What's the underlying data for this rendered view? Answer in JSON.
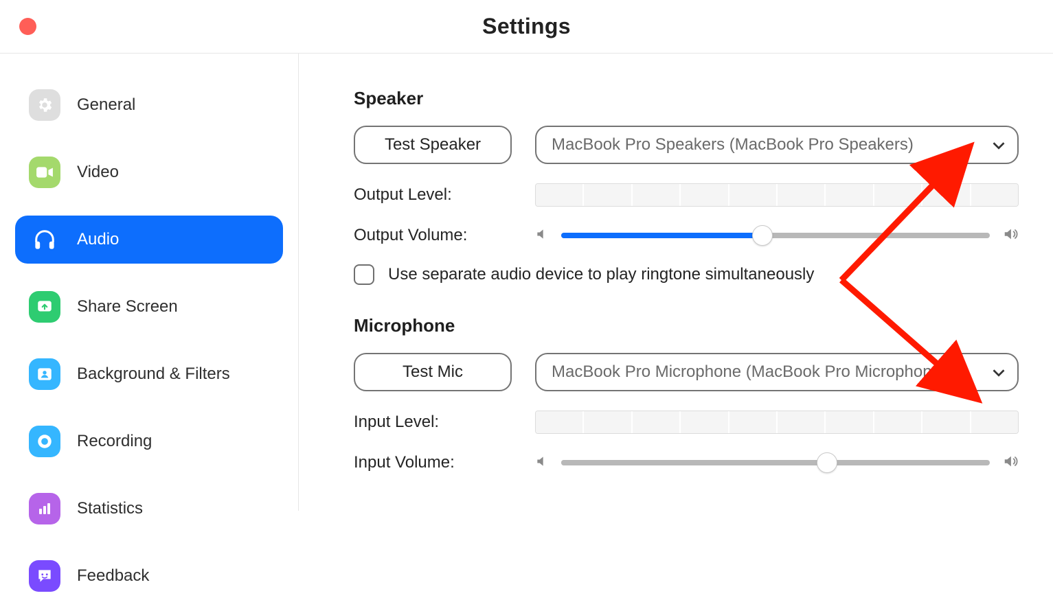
{
  "window": {
    "title": "Settings"
  },
  "sidebar": {
    "items": [
      {
        "id": "general",
        "label": "General"
      },
      {
        "id": "video",
        "label": "Video"
      },
      {
        "id": "audio",
        "label": "Audio"
      },
      {
        "id": "sharescreen",
        "label": "Share Screen"
      },
      {
        "id": "bgfilters",
        "label": "Background & Filters"
      },
      {
        "id": "recording",
        "label": "Recording"
      },
      {
        "id": "statistics",
        "label": "Statistics"
      },
      {
        "id": "feedback",
        "label": "Feedback"
      }
    ],
    "selected_id": "audio"
  },
  "audio": {
    "speaker": {
      "heading": "Speaker",
      "test_label": "Test Speaker",
      "device": "MacBook Pro Speakers (MacBook Pro Speakers)",
      "output_level_label": "Output Level:",
      "output_volume_label": "Output Volume:",
      "output_volume_percent": 47,
      "separate_ringtone_checked": false,
      "separate_ringtone_label": "Use separate audio device to play ringtone simultaneously"
    },
    "microphone": {
      "heading": "Microphone",
      "test_label": "Test Mic",
      "device": "MacBook Pro Microphone (MacBook Pro Microphone)",
      "input_level_label": "Input Level:",
      "input_volume_label": "Input Volume:",
      "input_volume_percent": 62
    }
  },
  "annotation": {
    "type": "double-arrow",
    "color": "#ff1a00",
    "note": "red annotation arrows pointing to speaker & microphone device dropdowns"
  }
}
